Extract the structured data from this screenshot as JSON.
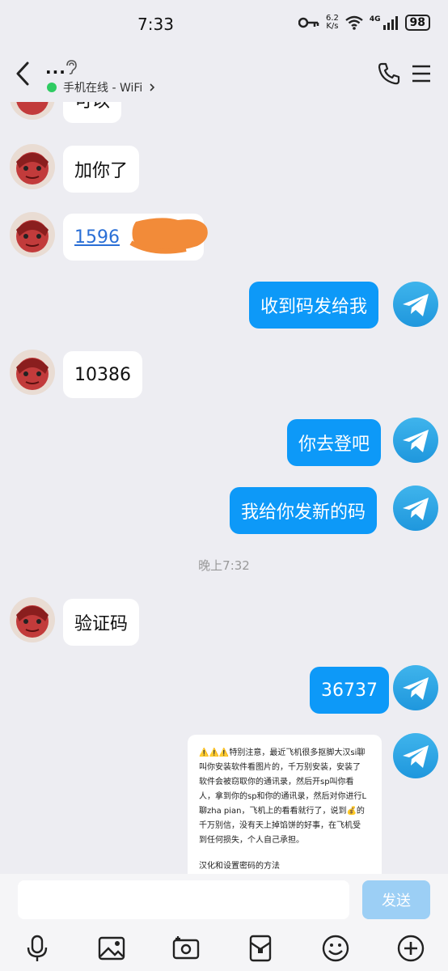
{
  "status": {
    "time": "7:33",
    "speed_value": "6.2",
    "speed_unit": "K/s",
    "network": "4G",
    "battery": "98"
  },
  "header": {
    "title": "...",
    "online_status": "手机在线 - WiFi"
  },
  "messages": [
    {
      "side": "left",
      "text": "可以"
    },
    {
      "side": "left",
      "text": "加你了"
    },
    {
      "side": "left",
      "text": "1596"
    },
    {
      "side": "right",
      "text": "收到码发给我"
    },
    {
      "side": "left",
      "text": "10386"
    },
    {
      "side": "right",
      "text": "你去登吧"
    },
    {
      "side": "right",
      "text": "我给你发新的码"
    },
    {
      "side": "left",
      "text": "验证码"
    },
    {
      "side": "right",
      "text": "36737"
    }
  ],
  "timestamp": "晚上7:32",
  "notice": {
    "lines": [
      "⚠️⚠️⚠️特别注意，最近飞机很多抠脚大汉si聊",
      "叫你安装软件看图片的，千万别安装，安装了",
      "软件会被窃取你的通讯录，然后开sp叫你看",
      "人，拿到你的sp和你的通讯录，然后对你进行L",
      "聊zha pian，飞机上的看看就行了，说到💰的",
      "千万别信，没有天上掉馅饼的好事，在飞机受",
      "到任何损失，个人自己承担。",
      "",
      "汉化和设置密码的方法"
    ]
  },
  "input": {
    "placeholder": "",
    "send_label": "发送"
  },
  "toolbar": {
    "icons": [
      "microphone-icon",
      "image-icon",
      "camera-icon",
      "red-packet-icon",
      "emoji-icon",
      "plus-icon"
    ]
  },
  "colors": {
    "bubble_right": "#0d99f8",
    "bubble_left": "#ffffff",
    "background": "#ededf2",
    "online_dot": "#2fcb62"
  }
}
